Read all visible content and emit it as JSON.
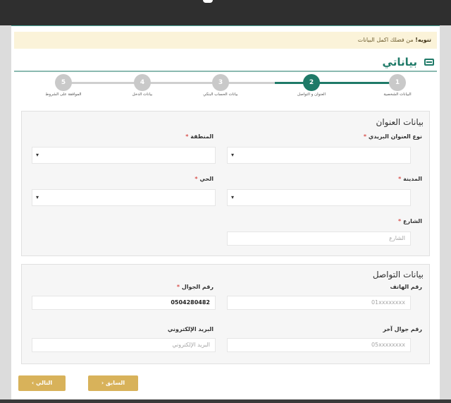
{
  "notice": {
    "strong": "تنويه!",
    "text": " من فضلك اكمل البيانات"
  },
  "page_title": "بياناتي",
  "steps": [
    {
      "number": "1",
      "label": "البيانات الشخصية"
    },
    {
      "number": "2",
      "label": "العنوان و التواصل"
    },
    {
      "number": "3",
      "label": "بيانات الحساب البنكي"
    },
    {
      "number": "4",
      "label": "بيانات الدخل"
    },
    {
      "number": "5",
      "label": "الموافقة على الشروط"
    }
  ],
  "address": {
    "title": "بيانات العنوان",
    "address_type": {
      "label": "نوع العنوان البريدي",
      "value": ""
    },
    "region": {
      "label": "المنطقة",
      "value": ""
    },
    "city": {
      "label": "المدينة",
      "value": ""
    },
    "district": {
      "label": "الحي",
      "value": ""
    },
    "street": {
      "label": "الشارع",
      "placeholder": "الشارع"
    }
  },
  "contact": {
    "title": "بيانات التواصل",
    "phone": {
      "label": "رقم الهاتف",
      "placeholder": "01xxxxxxxx"
    },
    "mobile": {
      "label": "رقم الجوال",
      "value": "0504280482"
    },
    "other_mobile": {
      "label": "رقم جوال آخر",
      "placeholder": "05xxxxxxxx"
    },
    "email": {
      "label": "البريد الإلكتروني",
      "placeholder": "البريد الإلكتروني"
    }
  },
  "buttons": {
    "previous": "السابق",
    "next": "التالي"
  },
  "required_mark": "*",
  "select_caret": "▾",
  "colors": {
    "primary": "#1f7a68",
    "button": "#d8b25a",
    "notice_bg": "#fbf3d9",
    "required": "#d9534f"
  }
}
